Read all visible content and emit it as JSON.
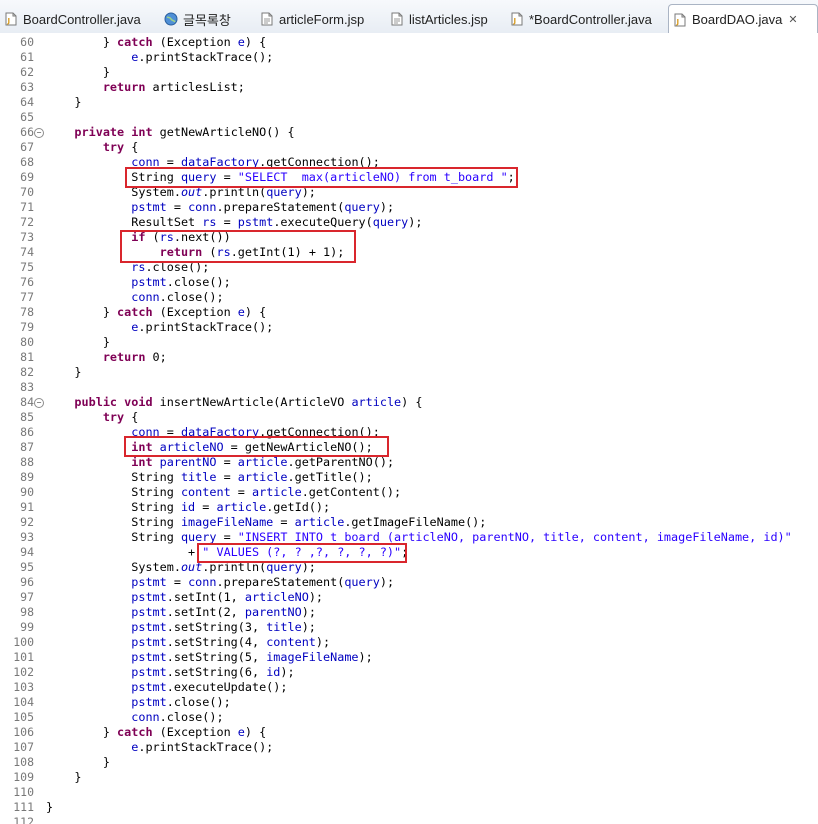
{
  "tabs": [
    {
      "label": "BoardController.java",
      "icon": "java-file-icon",
      "active": false
    },
    {
      "label": "글목록창",
      "icon": "web-browser-icon",
      "active": false
    },
    {
      "label": "articleForm.jsp",
      "icon": "jsp-file-icon",
      "active": false
    },
    {
      "label": "listArticles.jsp",
      "icon": "jsp-file-icon",
      "active": false
    },
    {
      "label": "*BoardController.java",
      "icon": "java-file-icon",
      "active": false
    },
    {
      "label": "BoardDAO.java",
      "icon": "java-file-icon",
      "active": true
    }
  ],
  "close_glyph": "✕",
  "colors": {
    "keyword": "#7f0055",
    "string": "#2a00ff",
    "field": "#0000c0",
    "line_number": "#787878",
    "highlight_box": "#d9262d"
  },
  "code_lines": [
    {
      "n": "60",
      "fold": false,
      "tokens": [
        [
          "        } ",
          ""
        ],
        [
          "catch",
          "kw"
        ],
        [
          " (Exception ",
          ""
        ],
        [
          "e",
          "fld"
        ],
        [
          ") {",
          ""
        ]
      ]
    },
    {
      "n": "61",
      "fold": false,
      "tokens": [
        [
          "            ",
          ""
        ],
        [
          "e",
          "fld"
        ],
        [
          ".printStackTrace();",
          ""
        ]
      ]
    },
    {
      "n": "62",
      "fold": false,
      "tokens": [
        [
          "        }",
          ""
        ]
      ]
    },
    {
      "n": "63",
      "fold": false,
      "tokens": [
        [
          "        ",
          ""
        ],
        [
          "return",
          "kw"
        ],
        [
          " articlesList;",
          ""
        ]
      ]
    },
    {
      "n": "64",
      "fold": false,
      "tokens": [
        [
          "    }",
          ""
        ]
      ]
    },
    {
      "n": "65",
      "fold": false,
      "tokens": []
    },
    {
      "n": "66",
      "fold": true,
      "tokens": [
        [
          "    ",
          ""
        ],
        [
          "private int",
          "kw"
        ],
        [
          " getNewArticleNO() {",
          ""
        ]
      ]
    },
    {
      "n": "67",
      "fold": false,
      "tokens": [
        [
          "        ",
          ""
        ],
        [
          "try",
          "kw"
        ],
        [
          " {",
          ""
        ]
      ]
    },
    {
      "n": "68",
      "fold": false,
      "tokens": [
        [
          "            ",
          ""
        ],
        [
          "conn",
          "fld"
        ],
        [
          " = ",
          ""
        ],
        [
          "dataFactory",
          "fld"
        ],
        [
          ".getConnection();",
          ""
        ]
      ]
    },
    {
      "n": "69",
      "fold": false,
      "tokens": [
        [
          "            String ",
          ""
        ],
        [
          "query",
          "fld"
        ],
        [
          " = ",
          ""
        ],
        [
          "\"SELECT  max(articleNO) from t_board \"",
          "str"
        ],
        [
          ";",
          ""
        ]
      ]
    },
    {
      "n": "70",
      "fold": false,
      "tokens": [
        [
          "            System.",
          ""
        ],
        [
          "out",
          "sfld"
        ],
        [
          ".println(",
          ""
        ],
        [
          "query",
          "fld"
        ],
        [
          ");",
          ""
        ]
      ]
    },
    {
      "n": "71",
      "fold": false,
      "tokens": [
        [
          "            ",
          ""
        ],
        [
          "pstmt",
          "fld"
        ],
        [
          " = ",
          ""
        ],
        [
          "conn",
          "fld"
        ],
        [
          ".prepareStatement(",
          ""
        ],
        [
          "query",
          "fld"
        ],
        [
          ");",
          ""
        ]
      ]
    },
    {
      "n": "72",
      "fold": false,
      "tokens": [
        [
          "            ResultSet ",
          ""
        ],
        [
          "rs",
          "fld"
        ],
        [
          " = ",
          ""
        ],
        [
          "pstmt",
          "fld"
        ],
        [
          ".executeQuery(",
          ""
        ],
        [
          "query",
          "fld"
        ],
        [
          ");",
          ""
        ]
      ]
    },
    {
      "n": "73",
      "fold": false,
      "tokens": [
        [
          "            ",
          ""
        ],
        [
          "if",
          "kw"
        ],
        [
          " (",
          ""
        ],
        [
          "rs",
          "fld"
        ],
        [
          ".next())",
          ""
        ]
      ]
    },
    {
      "n": "74",
      "fold": false,
      "tokens": [
        [
          "                ",
          ""
        ],
        [
          "return",
          "kw"
        ],
        [
          " (",
          ""
        ],
        [
          "rs",
          "fld"
        ],
        [
          ".getInt(1) + 1);",
          ""
        ]
      ]
    },
    {
      "n": "75",
      "fold": false,
      "tokens": [
        [
          "            ",
          ""
        ],
        [
          "rs",
          "fld"
        ],
        [
          ".close();",
          ""
        ]
      ]
    },
    {
      "n": "76",
      "fold": false,
      "tokens": [
        [
          "            ",
          ""
        ],
        [
          "pstmt",
          "fld"
        ],
        [
          ".close();",
          ""
        ]
      ]
    },
    {
      "n": "77",
      "fold": false,
      "tokens": [
        [
          "            ",
          ""
        ],
        [
          "conn",
          "fld"
        ],
        [
          ".close();",
          ""
        ]
      ]
    },
    {
      "n": "78",
      "fold": false,
      "tokens": [
        [
          "        } ",
          ""
        ],
        [
          "catch",
          "kw"
        ],
        [
          " (Exception ",
          ""
        ],
        [
          "e",
          "fld"
        ],
        [
          ") {",
          ""
        ]
      ]
    },
    {
      "n": "79",
      "fold": false,
      "tokens": [
        [
          "            ",
          ""
        ],
        [
          "e",
          "fld"
        ],
        [
          ".printStackTrace();",
          ""
        ]
      ]
    },
    {
      "n": "80",
      "fold": false,
      "tokens": [
        [
          "        }",
          ""
        ]
      ]
    },
    {
      "n": "81",
      "fold": false,
      "tokens": [
        [
          "        ",
          ""
        ],
        [
          "return",
          "kw"
        ],
        [
          " 0;",
          ""
        ]
      ]
    },
    {
      "n": "82",
      "fold": false,
      "tokens": [
        [
          "    }",
          ""
        ]
      ]
    },
    {
      "n": "83",
      "fold": false,
      "tokens": []
    },
    {
      "n": "84",
      "fold": true,
      "tokens": [
        [
          "    ",
          ""
        ],
        [
          "public void",
          "kw"
        ],
        [
          " insertNewArticle(ArticleVO ",
          ""
        ],
        [
          "article",
          "fld"
        ],
        [
          ") {",
          ""
        ]
      ]
    },
    {
      "n": "85",
      "fold": false,
      "tokens": [
        [
          "        ",
          ""
        ],
        [
          "try",
          "kw"
        ],
        [
          " {",
          ""
        ]
      ]
    },
    {
      "n": "86",
      "fold": false,
      "tokens": [
        [
          "            ",
          ""
        ],
        [
          "conn",
          "fld"
        ],
        [
          " = ",
          ""
        ],
        [
          "dataFactory",
          "fld"
        ],
        [
          ".getConnection();",
          ""
        ]
      ]
    },
    {
      "n": "87",
      "fold": false,
      "tokens": [
        [
          "            ",
          ""
        ],
        [
          "int",
          "kw"
        ],
        [
          " ",
          ""
        ],
        [
          "articleNO",
          "fld"
        ],
        [
          " = getNewArticleNO();",
          ""
        ]
      ]
    },
    {
      "n": "88",
      "fold": false,
      "tokens": [
        [
          "            ",
          ""
        ],
        [
          "int",
          "kw"
        ],
        [
          " ",
          ""
        ],
        [
          "parentNO",
          "fld"
        ],
        [
          " = ",
          ""
        ],
        [
          "article",
          "fld"
        ],
        [
          ".getParentNO();",
          ""
        ]
      ]
    },
    {
      "n": "89",
      "fold": false,
      "tokens": [
        [
          "            String ",
          ""
        ],
        [
          "title",
          "fld"
        ],
        [
          " = ",
          ""
        ],
        [
          "article",
          "fld"
        ],
        [
          ".getTitle();",
          ""
        ]
      ]
    },
    {
      "n": "90",
      "fold": false,
      "tokens": [
        [
          "            String ",
          ""
        ],
        [
          "content",
          "fld"
        ],
        [
          " = ",
          ""
        ],
        [
          "article",
          "fld"
        ],
        [
          ".getContent();",
          ""
        ]
      ]
    },
    {
      "n": "91",
      "fold": false,
      "tokens": [
        [
          "            String ",
          ""
        ],
        [
          "id",
          "fld"
        ],
        [
          " = ",
          ""
        ],
        [
          "article",
          "fld"
        ],
        [
          ".getId();",
          ""
        ]
      ]
    },
    {
      "n": "92",
      "fold": false,
      "tokens": [
        [
          "            String ",
          ""
        ],
        [
          "imageFileName",
          "fld"
        ],
        [
          " = ",
          ""
        ],
        [
          "article",
          "fld"
        ],
        [
          ".getImageFileName();",
          ""
        ]
      ]
    },
    {
      "n": "93",
      "fold": false,
      "tokens": [
        [
          "            String ",
          ""
        ],
        [
          "query",
          "fld"
        ],
        [
          " = ",
          ""
        ],
        [
          "\"INSERT INTO t_board (articleNO, parentNO, title, content, imageFileName, id)\"",
          "str"
        ]
      ]
    },
    {
      "n": "94",
      "fold": false,
      "tokens": [
        [
          "                    + ",
          ""
        ],
        [
          "\" VALUES (?, ? ,?, ?, ?, ?)\"",
          "str"
        ],
        [
          ";",
          ""
        ]
      ]
    },
    {
      "n": "95",
      "fold": false,
      "tokens": [
        [
          "            System.",
          ""
        ],
        [
          "out",
          "sfld"
        ],
        [
          ".println(",
          ""
        ],
        [
          "query",
          "fld"
        ],
        [
          ");",
          ""
        ]
      ]
    },
    {
      "n": "96",
      "fold": false,
      "tokens": [
        [
          "            ",
          ""
        ],
        [
          "pstmt",
          "fld"
        ],
        [
          " = ",
          ""
        ],
        [
          "conn",
          "fld"
        ],
        [
          ".prepareStatement(",
          ""
        ],
        [
          "query",
          "fld"
        ],
        [
          ");",
          ""
        ]
      ]
    },
    {
      "n": "97",
      "fold": false,
      "tokens": [
        [
          "            ",
          ""
        ],
        [
          "pstmt",
          "fld"
        ],
        [
          ".setInt(1, ",
          ""
        ],
        [
          "articleNO",
          "fld"
        ],
        [
          ");",
          ""
        ]
      ]
    },
    {
      "n": "98",
      "fold": false,
      "tokens": [
        [
          "            ",
          ""
        ],
        [
          "pstmt",
          "fld"
        ],
        [
          ".setInt(2, ",
          ""
        ],
        [
          "parentNO",
          "fld"
        ],
        [
          ");",
          ""
        ]
      ]
    },
    {
      "n": "99",
      "fold": false,
      "tokens": [
        [
          "            ",
          ""
        ],
        [
          "pstmt",
          "fld"
        ],
        [
          ".setString(3, ",
          ""
        ],
        [
          "title",
          "fld"
        ],
        [
          ");",
          ""
        ]
      ]
    },
    {
      "n": "100",
      "fold": false,
      "tokens": [
        [
          "            ",
          ""
        ],
        [
          "pstmt",
          "fld"
        ],
        [
          ".setString(4, ",
          ""
        ],
        [
          "content",
          "fld"
        ],
        [
          ");",
          ""
        ]
      ]
    },
    {
      "n": "101",
      "fold": false,
      "tokens": [
        [
          "            ",
          ""
        ],
        [
          "pstmt",
          "fld"
        ],
        [
          ".setString(5, ",
          ""
        ],
        [
          "imageFileName",
          "fld"
        ],
        [
          ");",
          ""
        ]
      ]
    },
    {
      "n": "102",
      "fold": false,
      "tokens": [
        [
          "            ",
          ""
        ],
        [
          "pstmt",
          "fld"
        ],
        [
          ".setString(6, ",
          ""
        ],
        [
          "id",
          "fld"
        ],
        [
          ");",
          ""
        ]
      ]
    },
    {
      "n": "103",
      "fold": false,
      "tokens": [
        [
          "            ",
          ""
        ],
        [
          "pstmt",
          "fld"
        ],
        [
          ".executeUpdate();",
          ""
        ]
      ]
    },
    {
      "n": "104",
      "fold": false,
      "tokens": [
        [
          "            ",
          ""
        ],
        [
          "pstmt",
          "fld"
        ],
        [
          ".close();",
          ""
        ]
      ]
    },
    {
      "n": "105",
      "fold": false,
      "tokens": [
        [
          "            ",
          ""
        ],
        [
          "conn",
          "fld"
        ],
        [
          ".close();",
          ""
        ]
      ]
    },
    {
      "n": "106",
      "fold": false,
      "tokens": [
        [
          "        } ",
          ""
        ],
        [
          "catch",
          "kw"
        ],
        [
          " (Exception ",
          ""
        ],
        [
          "e",
          "fld"
        ],
        [
          ") {",
          ""
        ]
      ]
    },
    {
      "n": "107",
      "fold": false,
      "tokens": [
        [
          "            ",
          ""
        ],
        [
          "e",
          "fld"
        ],
        [
          ".printStackTrace();",
          ""
        ]
      ]
    },
    {
      "n": "108",
      "fold": false,
      "tokens": [
        [
          "        }",
          ""
        ]
      ]
    },
    {
      "n": "109",
      "fold": false,
      "tokens": [
        [
          "    }",
          ""
        ]
      ]
    },
    {
      "n": "110",
      "fold": false,
      "tokens": []
    },
    {
      "n": "111",
      "fold": false,
      "tokens": [
        [
          "}",
          ""
        ]
      ]
    },
    {
      "n": "112",
      "fold": false,
      "tokens": []
    }
  ]
}
